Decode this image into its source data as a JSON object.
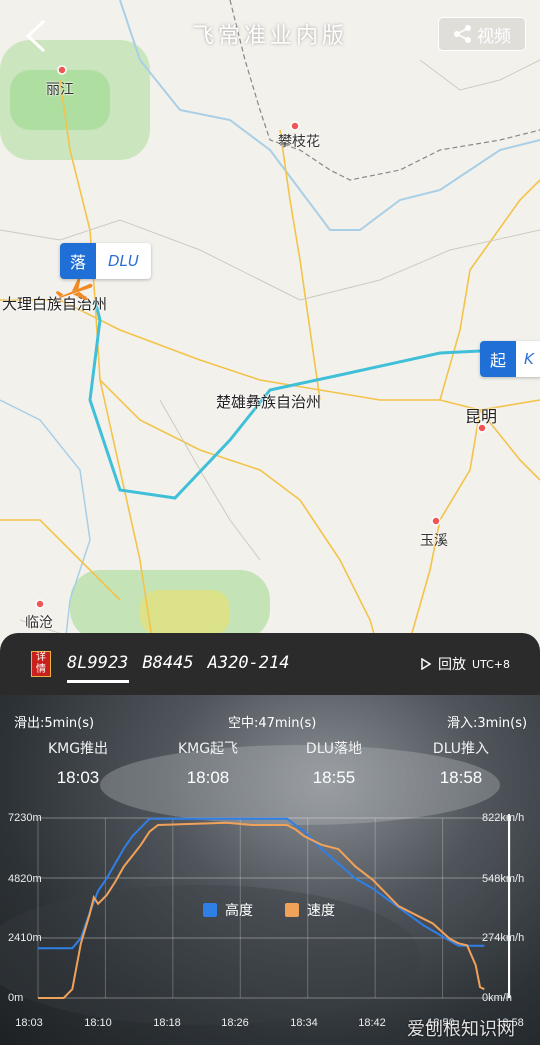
{
  "header": {
    "title": "飞常准业内版",
    "video_label": "视频"
  },
  "map": {
    "cities": {
      "lijiang": "丽江",
      "panzhihua": "攀枝花",
      "dali": "大理白族自治州",
      "chuxiong": "楚雄彝族自治州",
      "kunming": "昆明",
      "yuxi": "玉溪",
      "lincang": "临沧"
    },
    "landing_badge": {
      "tag": "落",
      "code": "DLU"
    },
    "departure_badge": {
      "tag": "起",
      "code": "K"
    }
  },
  "flight": {
    "flight_number": "8L9923",
    "registration": "B8445",
    "aircraft": "A320-214",
    "replay_label": "回放",
    "timezone": "UTC+8",
    "seal_text": "详情"
  },
  "phases": {
    "taxi_out": "滑出:5min(s)",
    "airborne": "空中:47min(s)",
    "taxi_in": "滑入:3min(s)"
  },
  "events": [
    {
      "label": "KMG推出",
      "time": "18:03"
    },
    {
      "label": "KMG起飞",
      "time": "18:08"
    },
    {
      "label": "DLU落地",
      "time": "18:55"
    },
    {
      "label": "DLU推入",
      "time": "18:58"
    }
  ],
  "chart_data": {
    "type": "line",
    "x_ticks": [
      "18:03",
      "18:10",
      "18:18",
      "18:26",
      "18:34",
      "18:42",
      "18:50",
      "18:58"
    ],
    "y_left_ticks": [
      "7230m",
      "4820m",
      "2410m",
      "0m"
    ],
    "y_right_ticks": [
      "822km/h",
      "548km/h",
      "274km/h",
      "0km/h"
    ],
    "ylim_altitude": [
      0,
      7230
    ],
    "ylim_speed": [
      0,
      822
    ],
    "series": [
      {
        "name": "高度",
        "color": "#2f7fe6",
        "unit": "m",
        "values": [
          [
            0,
            2000
          ],
          [
            4,
            2000
          ],
          [
            5,
            2400
          ],
          [
            6,
            3400
          ],
          [
            7,
            4300
          ],
          [
            8,
            4800
          ],
          [
            9,
            5400
          ],
          [
            10,
            6000
          ],
          [
            11,
            6500
          ],
          [
            13,
            7200
          ],
          [
            29,
            7200
          ],
          [
            31,
            6700
          ],
          [
            33,
            6000
          ],
          [
            35,
            5400
          ],
          [
            37,
            4800
          ],
          [
            39,
            4400
          ],
          [
            41,
            3900
          ],
          [
            43,
            3400
          ],
          [
            45,
            2900
          ],
          [
            47,
            2500
          ],
          [
            49,
            2100
          ],
          [
            52,
            2100
          ]
        ]
      },
      {
        "name": "速度",
        "color": "#f0a25a",
        "unit": "km/h",
        "values": [
          [
            0,
            0
          ],
          [
            3,
            0
          ],
          [
            4,
            40
          ],
          [
            5,
            250
          ],
          [
            6,
            380
          ],
          [
            6.5,
            460
          ],
          [
            7,
            430
          ],
          [
            8,
            470
          ],
          [
            9,
            530
          ],
          [
            10,
            600
          ],
          [
            11,
            650
          ],
          [
            12,
            700
          ],
          [
            13,
            760
          ],
          [
            14,
            790
          ],
          [
            22,
            800
          ],
          [
            25,
            790
          ],
          [
            29,
            790
          ],
          [
            30,
            770
          ],
          [
            31,
            740
          ],
          [
            33,
            700
          ],
          [
            35,
            680
          ],
          [
            37,
            600
          ],
          [
            39,
            540
          ],
          [
            41,
            460
          ],
          [
            42,
            420
          ],
          [
            44,
            380
          ],
          [
            46,
            340
          ],
          [
            48,
            270
          ],
          [
            49,
            250
          ],
          [
            50,
            240
          ],
          [
            51,
            150
          ],
          [
            51.5,
            50
          ],
          [
            52,
            40
          ]
        ]
      }
    ],
    "x_minutes_range": [
      0,
      55
    ],
    "legend_position": "center"
  },
  "colors": {
    "route": "#3fc0d8",
    "badge_blue": "#1f6fd6"
  },
  "watermark": "爱刨根知识网"
}
